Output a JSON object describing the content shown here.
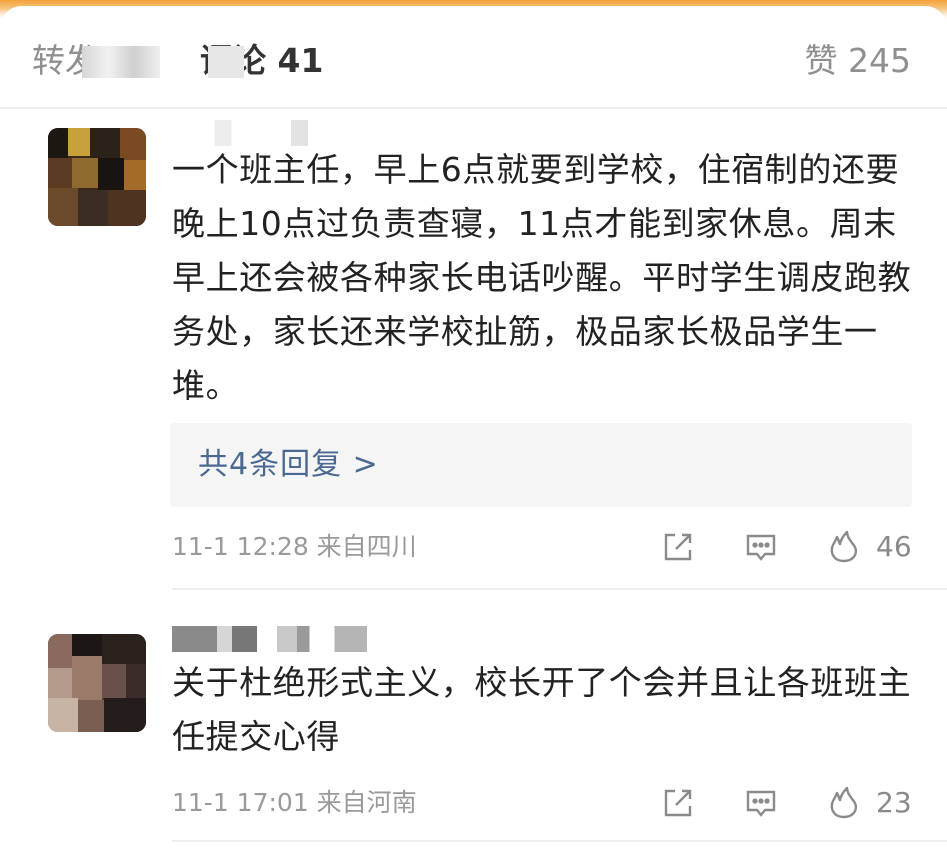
{
  "tabs": {
    "repost_label": "转发",
    "comment_label": "评论 41",
    "like_label": "赞 245"
  },
  "comments": [
    {
      "text": "一个班主任，早上6点就要到学校，住宿制的还要晚上10点过负责查寝，11点才能到家休息。周末早上还会被各种家长电话吵醒。平时学生调皮跑教务处，家长还来学校扯筋，极品家长极品学生一堆。",
      "replies_label": "共4条回复 >",
      "meta": "11-1 12:28 来自四川",
      "likes": "46"
    },
    {
      "text": "关于杜绝形式主义，校长开了个会并且让各班班主任提交心得",
      "meta": "11-1 17:01 来自河南",
      "likes": "23"
    }
  ],
  "icons": {
    "share": "share-icon",
    "reply": "comment-icon",
    "like": "flame-like-icon"
  },
  "colors": {
    "accent_top": "#f3a23a",
    "link_blue": "#4a6891",
    "meta_gray": "#9a9a9a"
  }
}
